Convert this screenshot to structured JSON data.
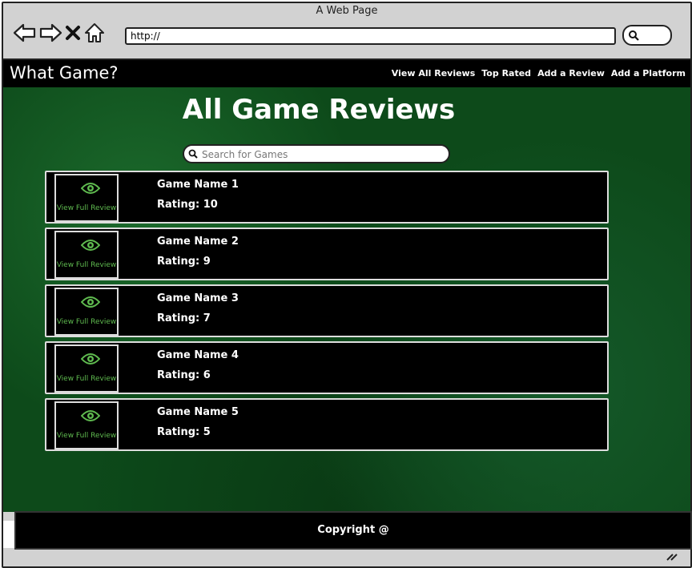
{
  "browser": {
    "title": "A Web Page",
    "url": "http://"
  },
  "header": {
    "brand": "What Game?",
    "nav": [
      "View All Reviews",
      "Top Rated",
      "Add a Review",
      "Add a Platform"
    ]
  },
  "main": {
    "title": "All Game Reviews",
    "search_placeholder": "Search for Games"
  },
  "reviews": [
    {
      "name": "Game Name 1",
      "rating": "Rating: 10",
      "action": "View Full Review"
    },
    {
      "name": "Game Name 2",
      "rating": "Rating: 9",
      "action": "View Full Review"
    },
    {
      "name": "Game Name 3",
      "rating": "Rating: 7",
      "action": "View Full Review"
    },
    {
      "name": "Game Name 4",
      "rating": "Rating: 6",
      "action": "View Full Review"
    },
    {
      "name": "Game Name 5",
      "rating": "Rating: 5",
      "action": "View Full Review"
    }
  ],
  "footer": {
    "copyright": "Copyright @"
  },
  "colors": {
    "accent": "#5fba4f",
    "background": "#0d4a1a",
    "panel": "#000000"
  },
  "icons": [
    "back-icon",
    "forward-icon",
    "close-icon",
    "home-icon",
    "search-icon",
    "eye-icon",
    "resize-icon"
  ]
}
